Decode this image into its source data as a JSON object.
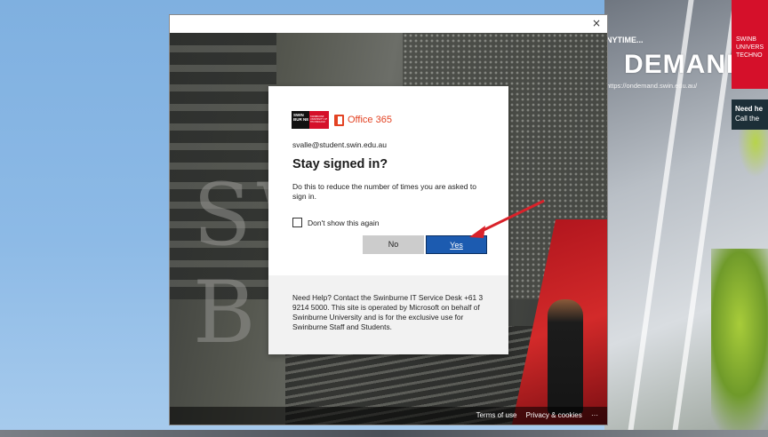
{
  "background_site": {
    "anytime_text": "NYTIME...",
    "demand_text": "DEMAND",
    "url_text": "https://ondemand.swin.edu.au/",
    "swin_box_text": "SWINB UNIVERS TECHNO",
    "help_title": "Need he",
    "help_text": "Call the"
  },
  "window": {
    "close_label": "×",
    "footer": {
      "terms_label": "Terms of use",
      "privacy_label": "Privacy & cookies",
      "more_label": "···"
    }
  },
  "background_photo": {
    "letters": "SW\nB"
  },
  "dialog": {
    "swinburne_logo_text": "SWIN BUR NE",
    "swinburne_tag_text": "SWINBURNE UNIVERSITY OF TECHNOLOGY",
    "office_label": "Office 365",
    "email": "svalle@student.swin.edu.au",
    "title": "Stay signed in?",
    "description": "Do this to reduce the number of times you are asked to sign in.",
    "checkbox_label": "Don't show this again",
    "checkbox_checked": false,
    "no_label": "No",
    "yes_label": "Yes",
    "help_text": "Need Help? Contact the Swinburne IT Service Desk +61 3 9214 5000. This site is operated by Microsoft on behalf of Swinburne University and is for the exclusive use for Swinburne Staff and Students."
  },
  "annotation": {
    "arrow_color": "#d9222a"
  },
  "colors": {
    "office_orange": "#e34222",
    "yes_blue": "#1c5bb0",
    "swin_red": "#d5102a"
  }
}
